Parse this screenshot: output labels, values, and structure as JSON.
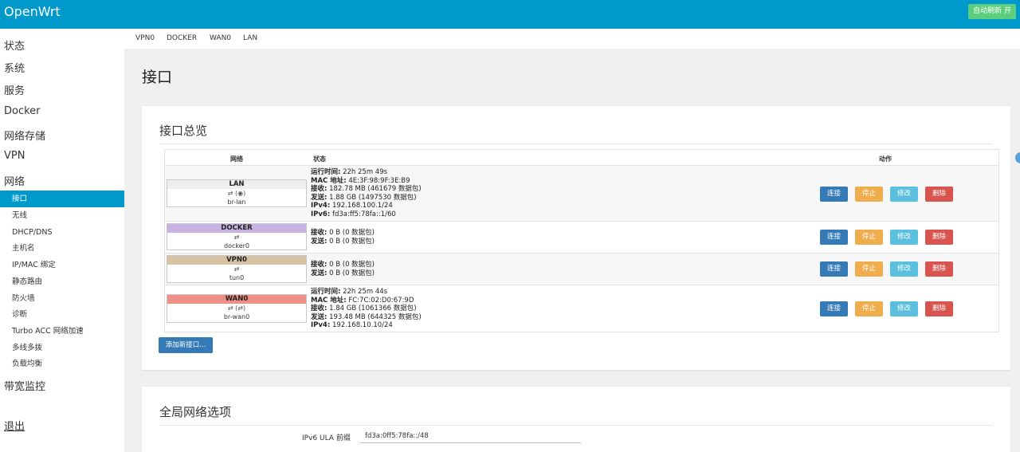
{
  "header": {
    "brand": "OpenWrt",
    "auto_refresh": "自动刷新 开"
  },
  "sidebar": {
    "top_items": [
      "状态",
      "系统",
      "服务",
      "Docker",
      "网络存储",
      "VPN",
      "网络"
    ],
    "network_sub": [
      "接口",
      "无线",
      "DHCP/DNS",
      "主机名",
      "IP/MAC 绑定",
      "静态路由",
      "防火墙",
      "诊断",
      "Turbo ACC 网络加速",
      "多线多拨",
      "负载均衡"
    ],
    "bandwidth": "带宽监控",
    "logout": "退出"
  },
  "tabs": [
    "VPN0",
    "DOCKER",
    "WAN0",
    "LAN"
  ],
  "page_title": "接口",
  "overview": {
    "title": "接口总览",
    "headers": {
      "network": "网络",
      "status": "状态",
      "actions": "动作"
    },
    "buttons": {
      "connect": "连接",
      "stop": "停止",
      "edit": "修改",
      "delete": "删除"
    },
    "rows": [
      {
        "name": "LAN",
        "color": "#eeeeee",
        "icons": "⇄ (◉)",
        "device": "br-lan",
        "stats": [
          {
            "k": "运行时间:",
            "v": "22h 25m 49s"
          },
          {
            "k": "MAC 地址:",
            "v": "4E:3F:98:9F:3E:B9"
          },
          {
            "k": "接收:",
            "v": "182.78 MB (461679 数据包)"
          },
          {
            "k": "发送:",
            "v": "1.88 GB (1497530 数据包)"
          },
          {
            "k": "IPv4:",
            "v": "192.168.100.1/24"
          },
          {
            "k": "IPv6:",
            "v": "fd3a:ff5:78fa::1/60"
          }
        ]
      },
      {
        "name": "DOCKER",
        "color": "#c9b1e2",
        "icons": "⇄",
        "device": "docker0",
        "stats": [
          {
            "k": "接收:",
            "v": "0 B (0 数据包)"
          },
          {
            "k": "发送:",
            "v": "0 B (0 数据包)"
          }
        ]
      },
      {
        "name": "VPN0",
        "color": "#d8c2a4",
        "icons": "⇄",
        "device": "tun0",
        "stats": [
          {
            "k": "接收:",
            "v": "0 B (0 数据包)"
          },
          {
            "k": "发送:",
            "v": "0 B (0 数据包)"
          }
        ]
      },
      {
        "name": "WAN0",
        "color": "#ee8f88",
        "icons": "⇄ (⇄)",
        "device": "br-wan0",
        "stats": [
          {
            "k": "运行时间:",
            "v": "22h 25m 44s"
          },
          {
            "k": "MAC 地址:",
            "v": "FC:7C:02:D0:67:9D"
          },
          {
            "k": "接收:",
            "v": "1.84 GB (1061366 数据包)"
          },
          {
            "k": "发送:",
            "v": "193.48 MB (644325 数据包)"
          },
          {
            "k": "IPv4:",
            "v": "192.168.10.10/24"
          }
        ]
      }
    ],
    "add_button": "添加新接口..."
  },
  "global": {
    "title": "全局网络选项",
    "ula_label": "IPv6 ULA 前缀",
    "ula_value": "fd3a:0ff5:78fa::/48"
  }
}
